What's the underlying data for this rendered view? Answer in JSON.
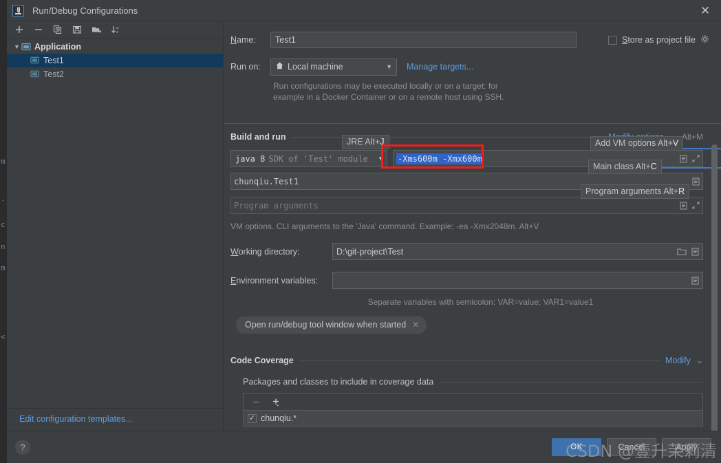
{
  "window": {
    "title": "Run/Debug Configurations",
    "app_icon": "intellij-idea-icon",
    "close_icon": "✕"
  },
  "left_panel": {
    "toolbar": [
      {
        "name": "add-configuration-button",
        "glyph": "+"
      },
      {
        "name": "remove-configuration-button",
        "glyph": "−"
      },
      {
        "name": "copy-configuration-button",
        "glyph": "copy-icon"
      },
      {
        "name": "save-configuration-button",
        "glyph": "save-icon"
      },
      {
        "name": "move-into-folder-button",
        "glyph": "folder-add-icon"
      },
      {
        "name": "sort-configurations-button",
        "glyph": "sort-az-icon"
      }
    ],
    "tree": {
      "group_label": "Application",
      "items": [
        {
          "label": "Test1",
          "selected": true
        },
        {
          "label": "Test2",
          "selected": false
        }
      ]
    },
    "edit_templates_link": "Edit configuration templates..."
  },
  "form": {
    "name_label": "Name:",
    "name_value": "Test1",
    "store_as_project_file_label": "Store as project file",
    "store_as_project_file_checked": false,
    "store_gear_icon": "gear-icon",
    "run_on_label": "Run on:",
    "run_on_value": "Local machine",
    "run_on_icon": "home-icon",
    "manage_targets_link": "Manage targets...",
    "run_on_hint_line1": "Run configurations may be executed locally or on a target: for",
    "run_on_hint_line2": "example in a Docker Container or on a remote host using SSH."
  },
  "build_and_run": {
    "section_title": "Build and run",
    "modify_options_link": "Modify options",
    "modify_options_shortcut": "Alt+M",
    "sdk_name": "java 8",
    "sdk_description": "SDK of 'Test' module",
    "vm_options_value": "-Xms600m  -Xmx600m",
    "main_class_value": "chunqiu.Test1",
    "program_arguments_placeholder": "Program arguments",
    "vm_options_description": "VM options. CLI arguments to the 'Java' command. Example: -ea -Xmx2048m. Alt+V",
    "working_directory_label": "Working directory:",
    "working_directory_value": "D:\\git-project\\Test",
    "environment_variables_label": "Environment variables:",
    "environment_variables_value": "",
    "environment_hint": "Separate variables with semicolon: VAR=value; VAR1=value1",
    "tool_window_chip": "Open run/debug tool window when started",
    "chip_close_icon": "✕"
  },
  "hints": [
    {
      "name": "hint-jre",
      "text": "JRE Alt+",
      "accent": "J"
    },
    {
      "name": "hint-add-vm-options",
      "text": "Add VM options Alt+",
      "accent": "V"
    },
    {
      "name": "hint-main-class",
      "text": "Main class Alt+",
      "accent": "C"
    },
    {
      "name": "hint-program-arguments",
      "text": "Program arguments Alt+",
      "accent": "R"
    }
  ],
  "code_coverage": {
    "section_title": "Code Coverage",
    "modify_link": "Modify",
    "packages_title": "Packages and classes to include in coverage data",
    "toolbar": [
      {
        "name": "remove-package-button",
        "glyph": "−"
      },
      {
        "name": "add-package-button",
        "glyph": "+"
      }
    ],
    "items": [
      {
        "label": "chunqiu.*",
        "checked": true
      }
    ]
  },
  "footer": {
    "help_icon": "?",
    "ok_label": "OK",
    "cancel_label": "Cancel",
    "apply_label": "Apply"
  },
  "watermark": "CSDN @壹升茉莉清",
  "colors": {
    "accent_blue": "#5c9de0",
    "selection_blue": "#2f65ca",
    "tree_selection": "#113a5c",
    "annotation_red": "#f81b1b",
    "ok_button": "#3f72ad",
    "panel_bg": "#3c3f41",
    "field_bg": "#45494a"
  },
  "backdrop_glyphs": [
    "m",
    "·",
    "c",
    "n",
    "m",
    "<"
  ]
}
